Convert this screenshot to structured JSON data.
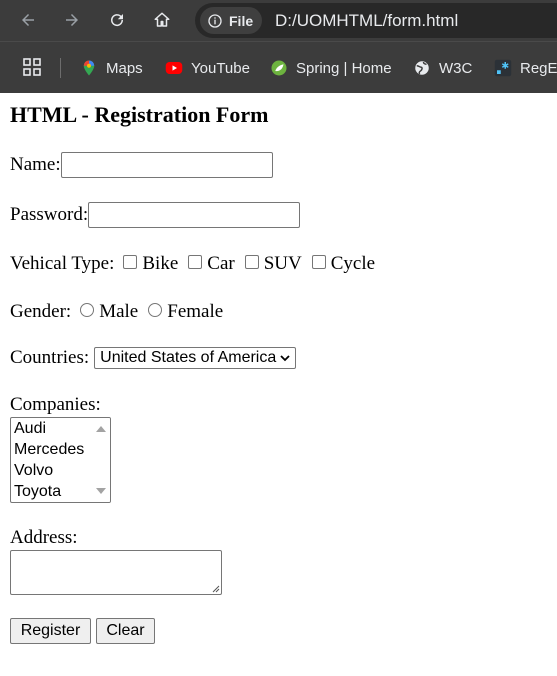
{
  "browser": {
    "chip_label": "File",
    "url": "D:/UOMHTML/form.html",
    "bookmarks": [
      {
        "label": "Maps",
        "icon": "maps-icon"
      },
      {
        "label": "YouTube",
        "icon": "youtube-icon"
      },
      {
        "label": "Spring | Home",
        "icon": "spring-icon"
      },
      {
        "label": "W3C",
        "icon": "globe-icon"
      },
      {
        "label": "RegEx",
        "icon": "regex-icon"
      }
    ]
  },
  "form": {
    "title": "HTML - Registration Form",
    "name_label": "Name:",
    "password_label": "Password:",
    "vehicle_label": "Vehical Type:",
    "vehicles": [
      "Bike",
      "Car",
      "SUV",
      "Cycle"
    ],
    "gender_label": "Gender:",
    "genders": [
      "Male",
      "Female"
    ],
    "countries_label": "Countries:",
    "country_selected": "United States of America",
    "companies_label": "Companies:",
    "companies": [
      "Audi",
      "Mercedes",
      "Volvo",
      "Toyota"
    ],
    "address_label": "Address:",
    "register_label": "Register",
    "clear_label": "Clear"
  },
  "colors": {
    "chrome_bg": "#3c3c3c",
    "omnibox_bg": "#282828",
    "youtube_red": "#ff0000",
    "spring_green": "#6db33f"
  }
}
